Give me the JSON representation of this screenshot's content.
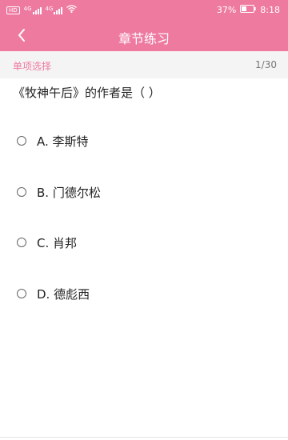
{
  "status_bar": {
    "hd_label": "HD",
    "sim1_label": "4G",
    "sim2_label": "4G",
    "battery_percent": "37%",
    "time": "8:18"
  },
  "nav": {
    "title": "章节练习"
  },
  "sub_header": {
    "question_type": "单项选择",
    "progress": "1/30"
  },
  "question": {
    "text": "《牧神午后》的作者是（ ）"
  },
  "options": [
    {
      "label": "A. 李斯特"
    },
    {
      "label": "B. 门德尔松"
    },
    {
      "label": "C. 肖邦"
    },
    {
      "label": "D. 德彪西"
    }
  ],
  "colors": {
    "accent": "#ee7aa0",
    "sub_header_bg": "#f4f4f4"
  }
}
